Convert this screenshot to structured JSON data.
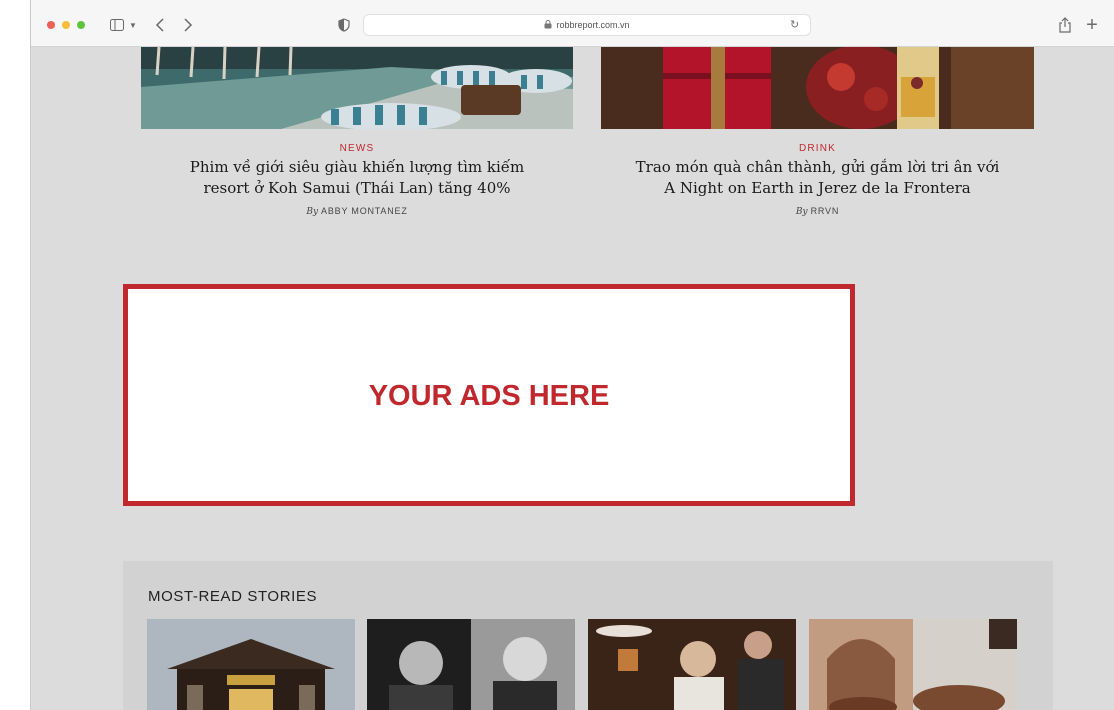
{
  "browser": {
    "url": "robbreport.com.vn",
    "icons": {
      "sidebar": "sidebar-icon",
      "chevron": "chevron-down-icon",
      "back": "back-arrow-icon",
      "forward": "forward-arrow-icon",
      "privacy": "shield-icon",
      "lock": "lock-icon",
      "reload": "reload-icon",
      "share": "share-icon",
      "new_tab": "plus-icon"
    }
  },
  "articles": [
    {
      "category": "NEWS",
      "title_line1": "Phim về giới siêu giàu khiến lượng tìm kiếm",
      "title_line2": "resort ở Koh Samui (Thái Lan) tăng 40%",
      "by": "By",
      "author": "ABBY MONTANEZ"
    },
    {
      "category": "DRINK",
      "title_line1": "Trao món quà chân thành, gửi gắm lời tri ân với",
      "title_line2": "A Night on Earth in Jerez de la Frontera",
      "by": "By",
      "author": "RRVN"
    }
  ],
  "ad": {
    "text": "YOUR ADS HERE"
  },
  "most_read": {
    "title": "MOST-READ STORIES"
  },
  "colors": {
    "accent": "#c0282d",
    "page_background": "#dcdcdc"
  }
}
